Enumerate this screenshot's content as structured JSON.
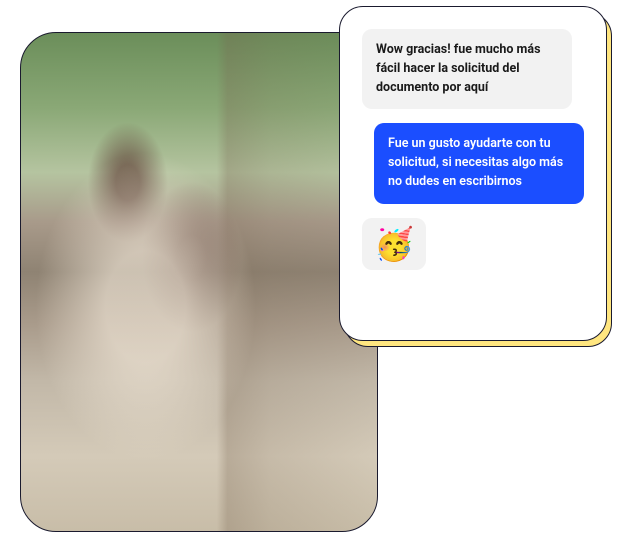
{
  "chat": {
    "messages": [
      {
        "side": "left",
        "text": "Wow gracias! fue mucho más fácil hacer la solicitud del documento por aquí"
      },
      {
        "side": "right",
        "text": "Fue un gusto ayudarte con tu solicitud, si necesitas algo más no dudes en escribirnos"
      },
      {
        "side": "left",
        "emoji": "🥳"
      }
    ]
  },
  "colors": {
    "accent": "#1b4eff",
    "shadow": "#ffe680",
    "border": "#1a1a2e"
  }
}
